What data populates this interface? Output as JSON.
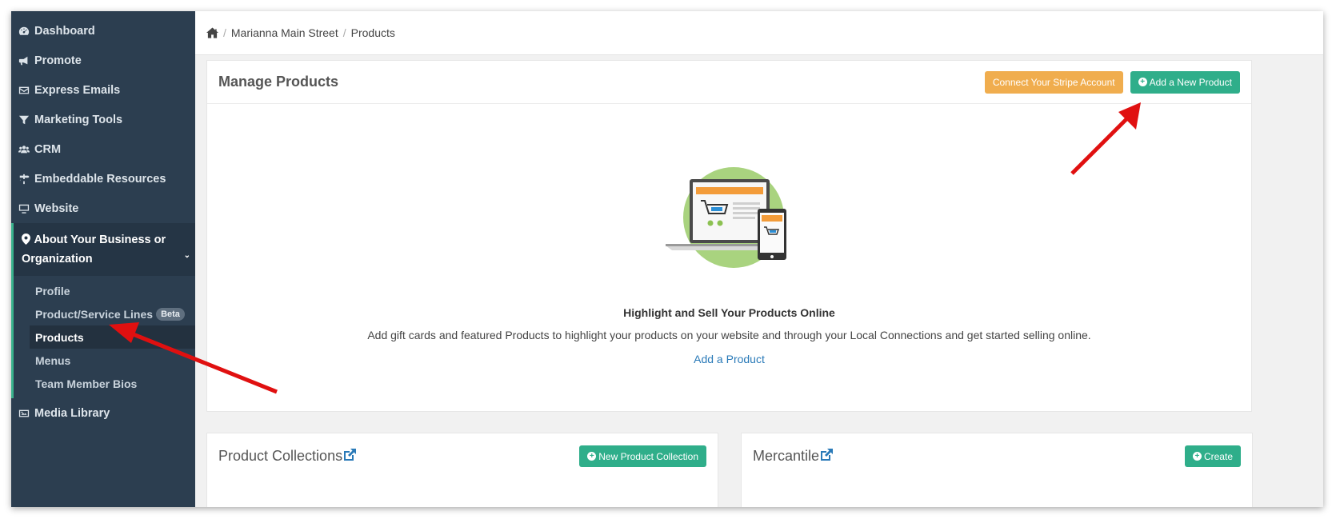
{
  "sidebar": {
    "items": [
      {
        "label": "Dashboard",
        "icon": "dashboard-icon"
      },
      {
        "label": "Promote",
        "icon": "megaphone-icon"
      },
      {
        "label": "Express Emails",
        "icon": "envelope-icon"
      },
      {
        "label": "Marketing Tools",
        "icon": "filter-icon"
      },
      {
        "label": "CRM",
        "icon": "users-icon"
      },
      {
        "label": "Embeddable Resources",
        "icon": "signs-icon"
      },
      {
        "label": "Website",
        "icon": "monitor-icon"
      }
    ],
    "open_section": {
      "label": "About Your Business or Organization",
      "icon": "map-marker-icon",
      "children": [
        {
          "label": "Profile"
        },
        {
          "label": "Product/Service Lines",
          "badge": "Beta"
        },
        {
          "label": "Products",
          "active": true
        },
        {
          "label": "Menus"
        },
        {
          "label": "Team Member Bios"
        }
      ]
    },
    "after": [
      {
        "label": "Media Library",
        "icon": "image-icon"
      }
    ]
  },
  "breadcrumb": {
    "items": [
      "Marianna Main Street",
      "Products"
    ]
  },
  "manage": {
    "title": "Manage Products",
    "stripe_button": "Connect Your Stripe Account",
    "add_button": "Add a New Product",
    "highlight_title": "Highlight and Sell Your Products Online",
    "highlight_desc": "Add gift cards and featured Products to highlight your products on your website and through your Local Connections and get started selling online.",
    "add_link": "Add a Product"
  },
  "collections": {
    "title": "Product Collections",
    "button": "New Product Collection"
  },
  "mercantile": {
    "title": "Mercantile",
    "button": "Create"
  },
  "colors": {
    "sidebar": "#2c3e50",
    "accent_green": "#2fae8a",
    "accent_orange": "#f0ad4e",
    "arrow_red": "#e01010"
  }
}
